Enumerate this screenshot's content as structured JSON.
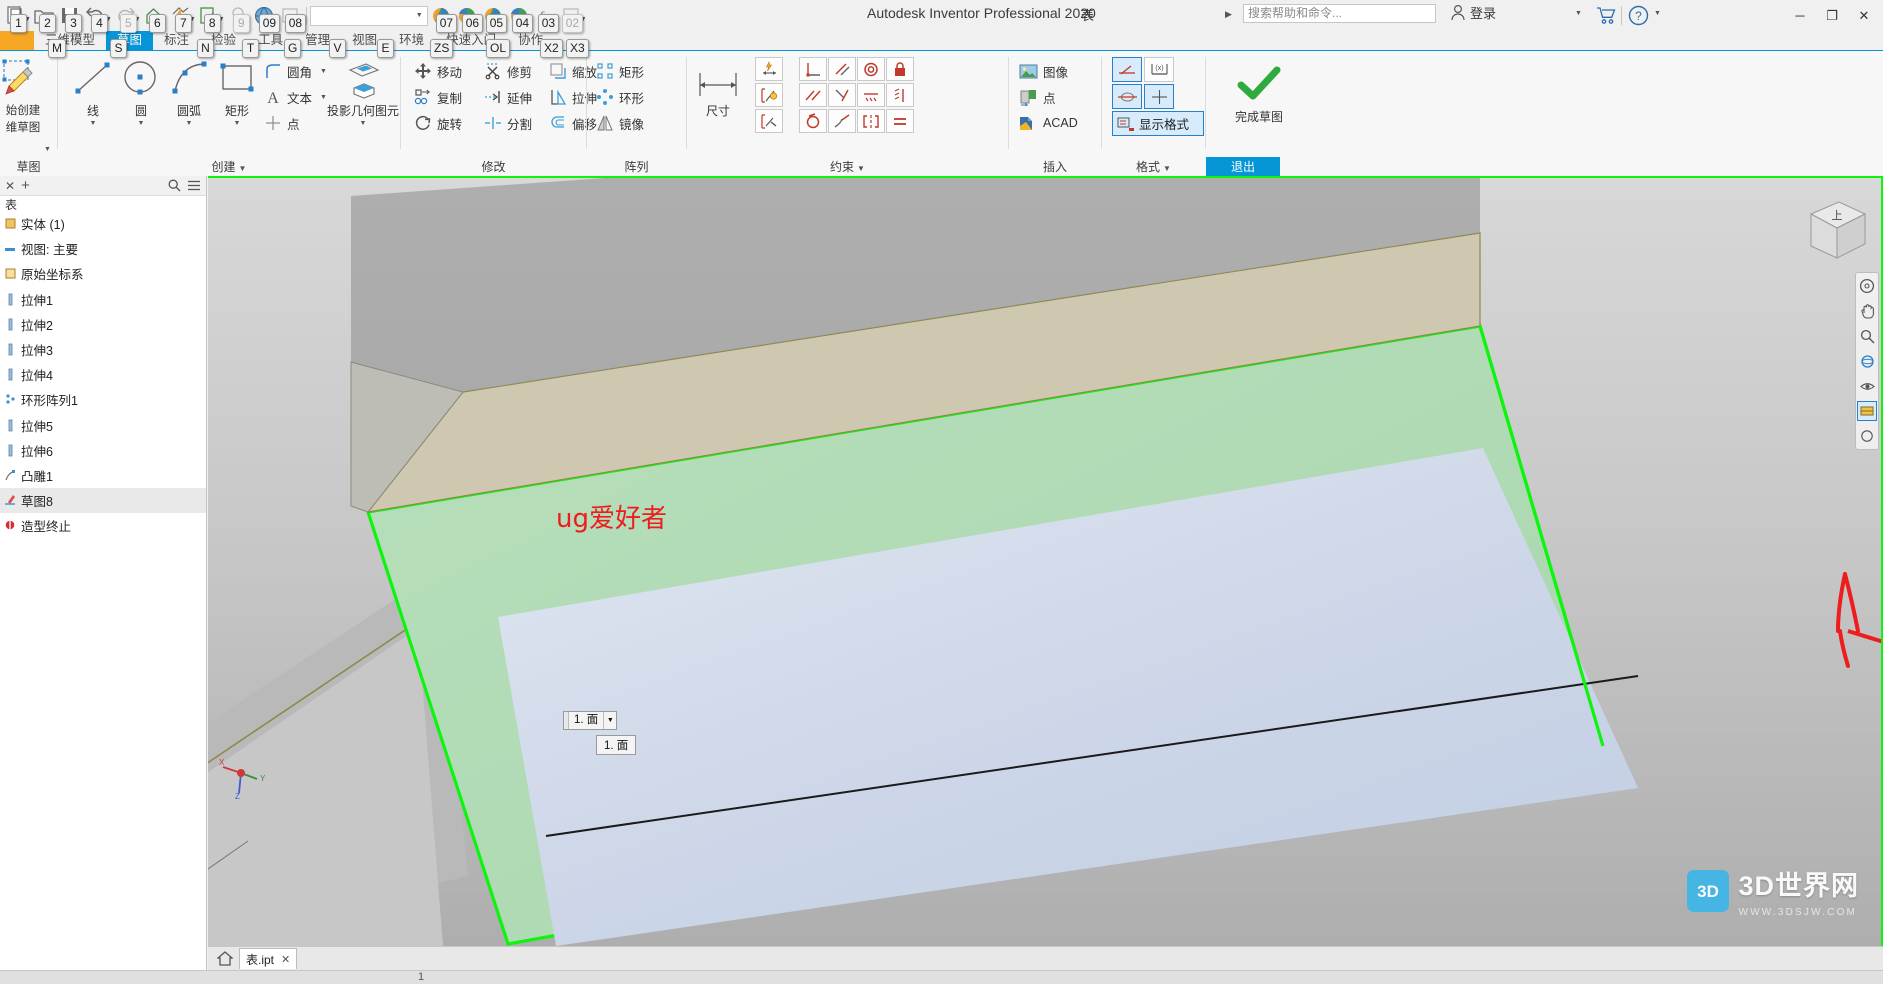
{
  "app": {
    "title": "Autodesk Inventor Professional 2020",
    "document_name": "表",
    "search_placeholder": "搜索帮助和命令...",
    "signin_label": "登录"
  },
  "quick_access": {
    "key_badges": [
      "1",
      "2",
      "3",
      "4",
      "5",
      "6",
      "7",
      "8",
      "9",
      "09",
      "08",
      "07",
      "06",
      "05",
      "04",
      "03",
      "02"
    ],
    "icons": [
      "new-document-icon",
      "open-folder-icon",
      "save-icon",
      "undo-icon",
      "redo-icon",
      "home-icon",
      "update-icon",
      "return-icon",
      "measure-icon",
      "appearance-icon",
      "material-icon",
      "appearance-sphere-icon",
      "color-sphere-icon",
      "clear-icon",
      "parameters-icon"
    ],
    "window_buttons": [
      "minimize",
      "restore",
      "close"
    ],
    "cart_icon": "shopping-cart-icon",
    "help_icon": "help-question-icon"
  },
  "ribbon": {
    "tabs": [
      {
        "label": "三维模型",
        "active": false
      },
      {
        "label": "草图",
        "active": true
      },
      {
        "label": "标注",
        "active": false
      },
      {
        "label": "检验",
        "active": false
      },
      {
        "label": "工具",
        "active": false
      },
      {
        "label": "管理",
        "active": false
      },
      {
        "label": "视图",
        "active": false
      },
      {
        "label": "环境",
        "active": false
      },
      {
        "label": "快速入门",
        "active": false
      },
      {
        "label": "协作",
        "active": false
      }
    ],
    "tab_key_badges": [
      "M",
      "S",
      "N",
      "T",
      "G",
      "V",
      "E",
      "ZS",
      "OL",
      "X2",
      "X3"
    ],
    "panels": [
      {
        "label": "草图",
        "dropdown": false
      },
      {
        "label": "创建",
        "dropdown": true
      },
      {
        "label": "修改",
        "dropdown": false
      },
      {
        "label": "阵列",
        "dropdown": false
      },
      {
        "label": "约束",
        "dropdown": true
      },
      {
        "label": "插入",
        "dropdown": false
      },
      {
        "label": "格式",
        "dropdown": true
      },
      {
        "label": "退出",
        "dropdown": false,
        "highlight": true
      }
    ],
    "sketch_panel": {
      "start_sketch_label_line1": "始创建",
      "start_sketch_label_line2": "维草图"
    },
    "create_panel": {
      "line": "线",
      "circle": "圆",
      "arc": "圆弧",
      "rectangle": "矩形",
      "fillet": "圆角",
      "text": "文本",
      "point": "点",
      "project_geometry": "投影几何图元"
    },
    "modify_panel": {
      "move": "移动",
      "copy": "复制",
      "rotate": "旋转",
      "trim": "修剪",
      "extend": "延伸",
      "split": "分割",
      "scale": "缩放",
      "stretch": "拉伸",
      "offset": "偏移"
    },
    "pattern_panel": {
      "rectangular": "矩形",
      "circular": "环形",
      "mirror": "镜像"
    },
    "dimension_panel": {
      "label": "尺寸"
    },
    "constraint_panel": {
      "icons": [
        "perpendicular-icon",
        "parallel-icon",
        "tangent-icon",
        "coincident-icon",
        "concentric-icon",
        "collinear-icon",
        "horizontal-icon",
        "vertical-icon",
        "equal-icon",
        "fix-icon",
        "smooth-icon",
        "symmetric-icon"
      ],
      "auto_icons": [
        "auto-dimension-icon",
        "show-constraints-icon",
        "relax-mode-icon"
      ]
    },
    "insert_panel": {
      "image": "图像",
      "point": "点",
      "acad": "ACAD"
    },
    "format_panel": {
      "construction": "construction-line-icon",
      "driven_dimension": "driven-dimension-icon",
      "centerline": "centerline-icon",
      "center_point": "center-point-icon",
      "show_format_label": "显示格式"
    },
    "exit_panel": {
      "finish_sketch": "完成草图",
      "icon": "green-check-icon"
    }
  },
  "browser": {
    "header_icons": [
      "close-icon",
      "add-icon",
      "search-icon",
      "menu-icon"
    ],
    "root": "表",
    "items": [
      {
        "label": "实体 (1)",
        "icon": "solid-bodies-icon",
        "selected": false
      },
      {
        "label": "视图: 主要",
        "icon": "view-icon",
        "selected": false
      },
      {
        "label": "原始坐标系",
        "icon": "origin-icon",
        "selected": false
      },
      {
        "label": "拉伸1",
        "icon": "extrude-icon",
        "selected": false
      },
      {
        "label": "拉伸2",
        "icon": "extrude-icon",
        "selected": false
      },
      {
        "label": "拉伸3",
        "icon": "extrude-icon",
        "selected": false
      },
      {
        "label": "拉伸4",
        "icon": "extrude-icon",
        "selected": false
      },
      {
        "label": "环形阵列1",
        "icon": "circular-pattern-icon",
        "selected": false
      },
      {
        "label": "拉伸5",
        "icon": "extrude-icon",
        "selected": false
      },
      {
        "label": "拉伸6",
        "icon": "extrude-icon",
        "selected": false
      },
      {
        "label": "凸雕1",
        "icon": "emboss-icon",
        "selected": false
      },
      {
        "label": "草图8",
        "icon": "sketch-icon",
        "selected": true
      },
      {
        "label": "造型终止",
        "icon": "end-of-part-icon",
        "selected": false
      }
    ]
  },
  "viewport": {
    "annotation_text": "ug爱好者",
    "face_chip_label": "1. 面",
    "face_tooltip_label": "1. 面",
    "nav_icons": [
      "viewcube-icon",
      "full-navigation-wheel-icon",
      "pan-hand-icon",
      "zoom-magnifier-icon",
      "orbit-icon",
      "look-at-icon",
      "display-style-icon"
    ],
    "viewcube_label": "上",
    "axis_labels": {
      "x": "X",
      "y": "Y",
      "z": "Z"
    },
    "selection_highlight_color": "#0ef40e",
    "annotation_color": "#ee1c1c"
  },
  "watermark": {
    "line1": "3D世界网",
    "line2": "WWW.3DSJW.COM"
  },
  "bottom": {
    "home_icon": "home-icon",
    "document_tab": "表.ipt",
    "close_tab_icon": "close-icon",
    "status_text": "1"
  }
}
